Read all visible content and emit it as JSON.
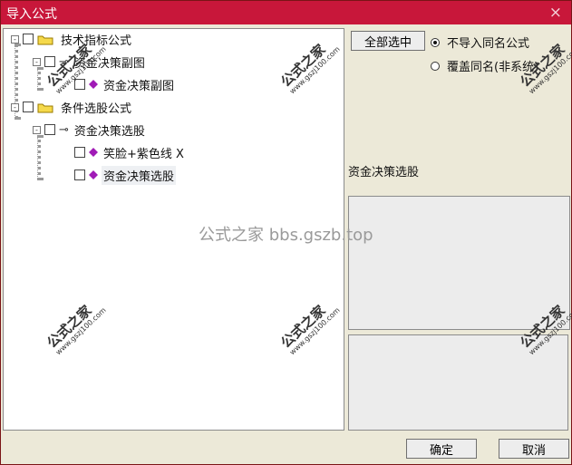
{
  "window": {
    "title": "导入公式",
    "close_icon": "close-icon"
  },
  "tree": {
    "items": [
      {
        "label": "技术指标公式"
      },
      {
        "label": "资金决策副图"
      },
      {
        "label": "资金决策副图"
      },
      {
        "label": "条件选股公式"
      },
      {
        "label": "资金决策选股"
      },
      {
        "label": "笑脸+紫色线 X"
      },
      {
        "label": "资金决策选股"
      }
    ],
    "expander_symbol": "-"
  },
  "right": {
    "select_all": "全部选中",
    "options": [
      "不导入同名公式",
      "覆盖同名(非系统)"
    ],
    "selected_option": "不导入同名公式",
    "formula_name": "资金决策选股"
  },
  "footer": {
    "ok": "确定",
    "cancel": "取消"
  },
  "watermarks": {
    "center": "公式之家 bbs.gszb.top",
    "stamp_title": "公式之家",
    "stamp_site": "www.gszj100.com"
  },
  "colors": {
    "title_bar": "#c8173a",
    "folder": "#f5d94b",
    "gem": "#a01bb6"
  }
}
